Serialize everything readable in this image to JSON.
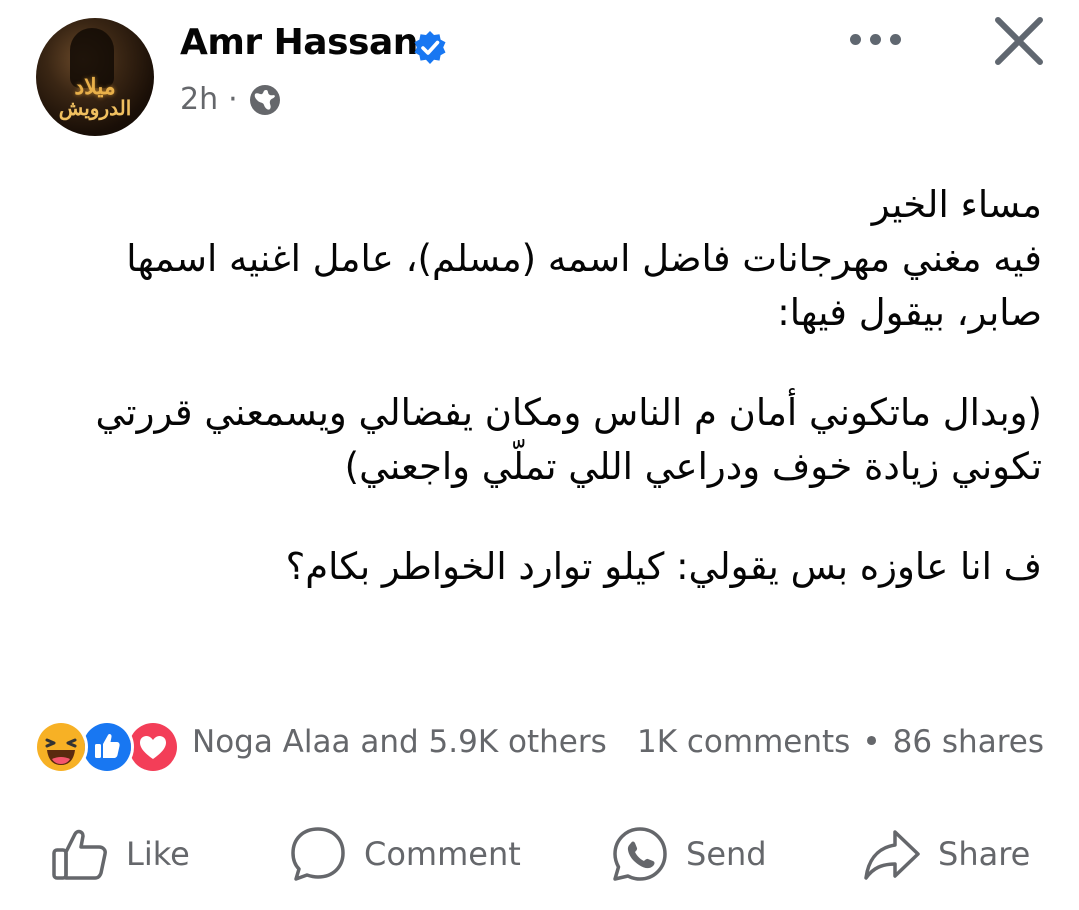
{
  "post": {
    "author": "Amr Hassan",
    "time": "2h",
    "time_separator": "·",
    "avatar_text": [
      "ميلاد",
      "الدرويش"
    ],
    "paragraphs": [
      "مساء الخير",
      "فيه مغني مهرجانات فاضل اسمه (مسلم)، عامل اغنيه اسمها صابر، بيقول فيها:",
      "(وبدال ماتكوني أمان م الناس ومكان يفضالي ويسمعني قررتي تكوني زيادة خوف ودراعي اللي تملّي واجعني)",
      "ف انا عاوزه بس يقولي: كيلو توارد الخواطر بكام؟"
    ]
  },
  "reactions": {
    "types": [
      "haha-icon",
      "like-icon",
      "love-icon"
    ],
    "reactors": "Noga Alaa and 5.9K others",
    "comments": "1K comments",
    "separator": "•",
    "shares": "86 shares"
  },
  "actions": {
    "like": "Like",
    "comment": "Comment",
    "send": "Send",
    "share": "Share"
  },
  "colors": {
    "verified": "#1877f2",
    "secondary_text": "#65676b",
    "like_blue": "#1877f2",
    "love_red": "#f33e58",
    "haha_yellow": "#f7b125"
  }
}
